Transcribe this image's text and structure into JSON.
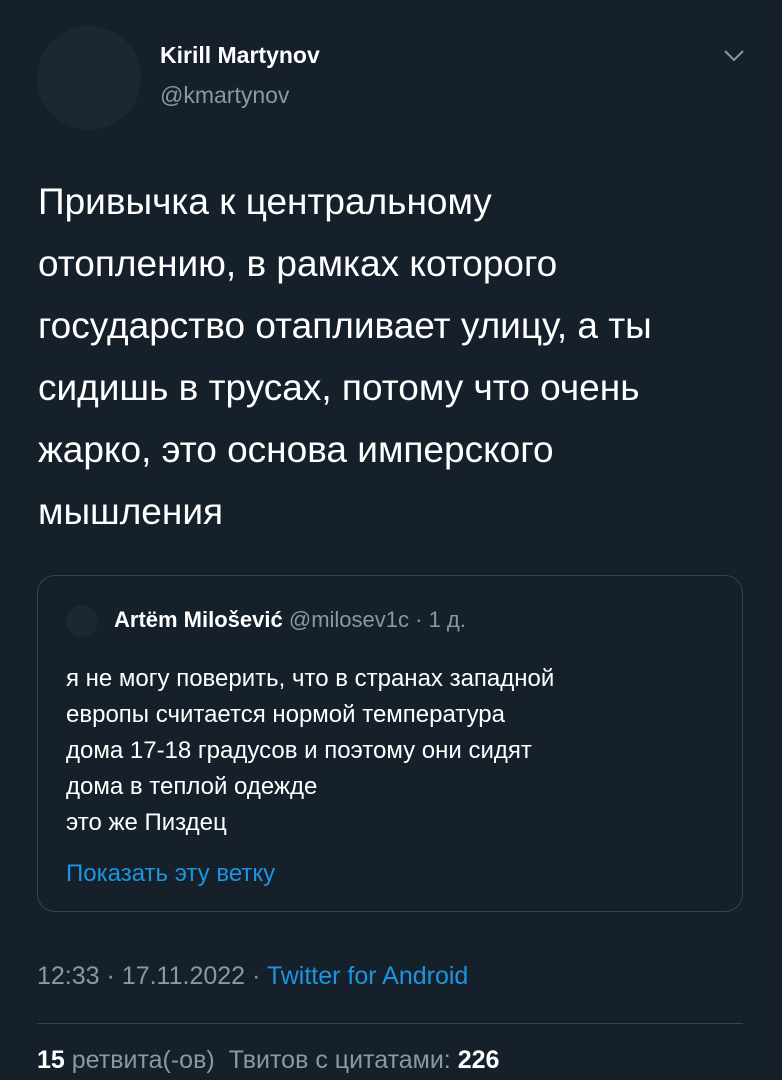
{
  "author": {
    "name": "Kirill Martynov",
    "handle": "@kmartynov"
  },
  "tweet": {
    "text": "Привычка к центральному\nотоплению, в рамках которого\nгосударство отапливает улицу, а ты\nсидишь в трусах, потому что очень\nжарко, это основа имперского\nмышления"
  },
  "quote": {
    "name": "Artëm Milošević",
    "handle": "@milosev1c",
    "separator": "·",
    "time": "1 д.",
    "text": "я не могу поверить, что в странах западной\nевропы считается нормой температура\nдома 17-18 градусов и поэтому они сидят\nдома в теплой одежде\nэто же Пиздец",
    "show_thread": "Показать эту ветку"
  },
  "meta": {
    "time": "12:33",
    "separator": "·",
    "date": "17.11.2022",
    "separator2": "·",
    "app": "Twitter for Android"
  },
  "stats": {
    "retweets_count": "15",
    "retweets_label": "ретвита(-ов)",
    "quotes_label": "Твитов с цитатами:",
    "quotes_count": "226"
  },
  "icons": {
    "caret": "chevron-down-icon"
  },
  "colors": {
    "background": "#15202b",
    "text_primary": "#ffffff",
    "text_secondary": "#8899a6",
    "link": "#1b95e0",
    "border": "#38444d"
  }
}
